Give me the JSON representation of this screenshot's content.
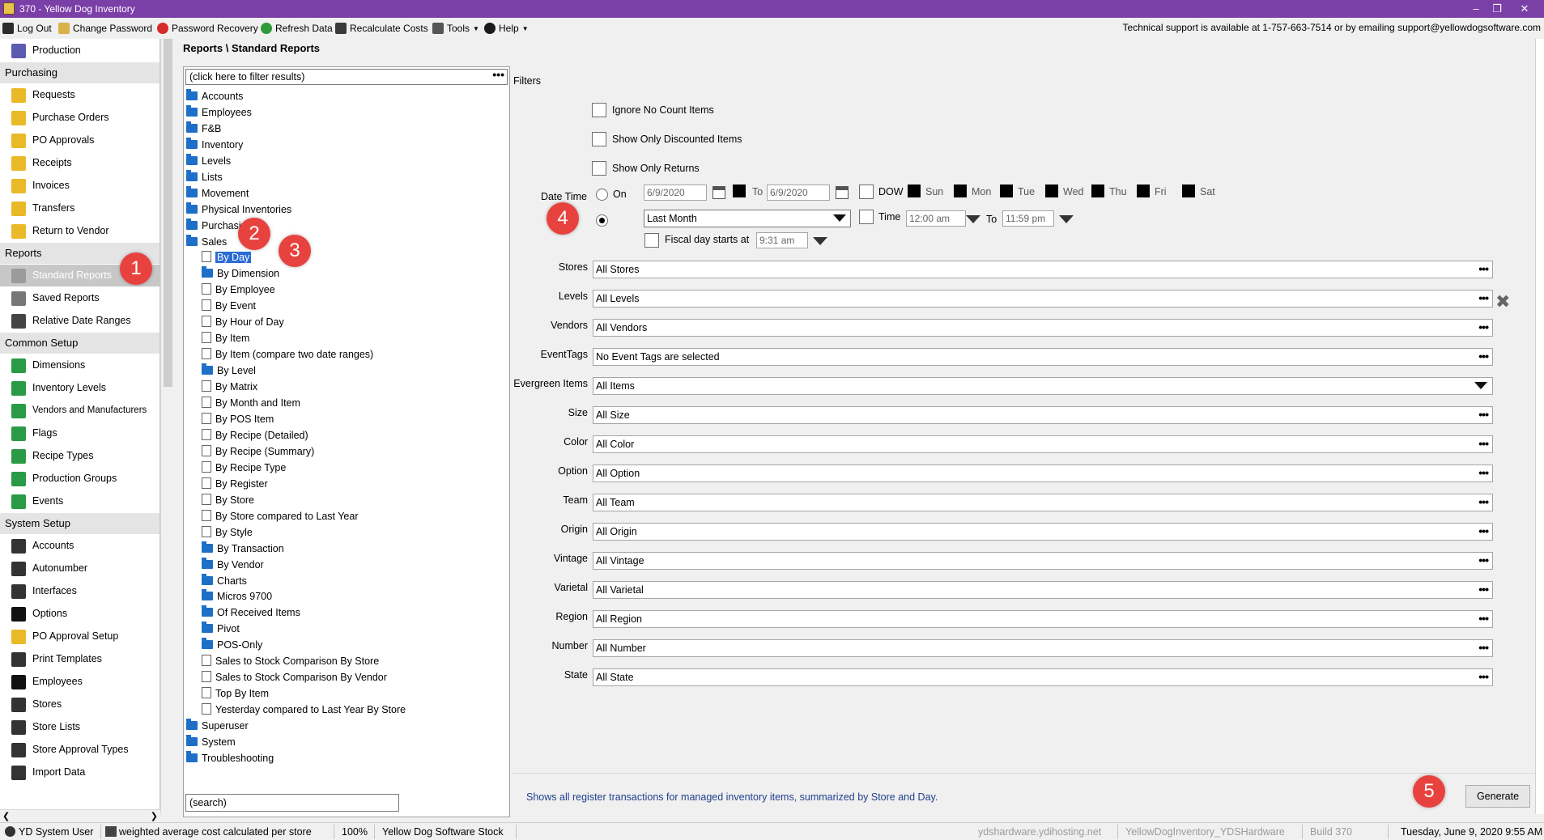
{
  "window": {
    "title": "370 - Yellow Dog Inventory"
  },
  "toolbar": {
    "items": [
      "Log Out",
      "Change Password",
      "Password Recovery",
      "Refresh Data",
      "Recalculate Costs",
      "Tools",
      "Help"
    ],
    "support": "Technical support is available at 1-757-663-7514 or by emailing support@yellowdogsoftware.com"
  },
  "sidebar": {
    "production": "Production",
    "purchasing_header": "Purchasing",
    "purchasing": [
      "Requests",
      "Purchase Orders",
      "PO Approvals",
      "Receipts",
      "Invoices",
      "Transfers",
      "Return to Vendor"
    ],
    "reports_header": "Reports",
    "reports": [
      "Standard Reports",
      "Saved Reports",
      "Relative Date Ranges"
    ],
    "common_header": "Common Setup",
    "common": [
      "Dimensions",
      "Inventory Levels",
      "Vendors and Manufacturers",
      "Flags",
      "Recipe Types",
      "Production Groups",
      "Events"
    ],
    "system_header": "System Setup",
    "system": [
      "Accounts",
      "Autonumber",
      "Interfaces",
      "Options",
      "PO Approval Setup",
      "Print Templates",
      "Employees",
      "Stores",
      "Store Lists",
      "Store Approval Types",
      "Import Data"
    ]
  },
  "breadcrumb": "Reports \\ Standard Reports",
  "tree": {
    "filter_placeholder": "(click here to filter results)",
    "search_placeholder": "(search)",
    "top_folders": [
      "Accounts",
      "Employees",
      "F&B",
      "Inventory",
      "Levels",
      "Lists",
      "Movement",
      "Physical Inventories",
      "Purchasing"
    ],
    "sales_label": "Sales",
    "sales_children": [
      {
        "label": "By Day",
        "type": "doc"
      },
      {
        "label": "By Dimension",
        "type": "folder"
      },
      {
        "label": "By Employee",
        "type": "doc"
      },
      {
        "label": "By Event",
        "type": "doc"
      },
      {
        "label": "By Hour of Day",
        "type": "doc"
      },
      {
        "label": "By Item",
        "type": "doc"
      },
      {
        "label": "By Item (compare two date ranges)",
        "type": "doc"
      },
      {
        "label": "By Level",
        "type": "folder"
      },
      {
        "label": "By Matrix",
        "type": "doc"
      },
      {
        "label": "By Month and Item",
        "type": "doc"
      },
      {
        "label": "By POS Item",
        "type": "doc"
      },
      {
        "label": "By Recipe (Detailed)",
        "type": "doc"
      },
      {
        "label": "By Recipe (Summary)",
        "type": "doc"
      },
      {
        "label": "By Recipe Type",
        "type": "doc"
      },
      {
        "label": "By Register",
        "type": "doc"
      },
      {
        "label": "By Store",
        "type": "doc"
      },
      {
        "label": "By Store compared to Last Year",
        "type": "doc"
      },
      {
        "label": "By Style",
        "type": "doc"
      },
      {
        "label": "By Transaction",
        "type": "folder"
      },
      {
        "label": "By Vendor",
        "type": "folder"
      },
      {
        "label": "Charts",
        "type": "folder"
      },
      {
        "label": "Micros 9700",
        "type": "folder"
      },
      {
        "label": "Of Received Items",
        "type": "folder"
      },
      {
        "label": "Pivot",
        "type": "folder"
      },
      {
        "label": "POS-Only",
        "type": "folder"
      },
      {
        "label": "Sales to Stock Comparison By Store",
        "type": "doc"
      },
      {
        "label": "Sales to Stock Comparison By Vendor",
        "type": "doc"
      },
      {
        "label": "Top By Item",
        "type": "doc"
      },
      {
        "label": "Yesterday compared to Last Year By Store",
        "type": "doc"
      }
    ],
    "bottom_folders": [
      "Superuser",
      "System",
      "Troubleshooting"
    ]
  },
  "filters": {
    "heading": "Filters",
    "checkboxes": [
      "Ignore No Count Items",
      "Show Only Discounted Items",
      "Show Only Returns"
    ],
    "date_time_label": "Date Time",
    "on_label": "On",
    "date_from": "6/9/2020",
    "to_label": "To",
    "date_to": "6/9/2020",
    "dow_label": "DOW",
    "days": [
      "Sun",
      "Mon",
      "Tue",
      "Wed",
      "Thu",
      "Fri",
      "Sat"
    ],
    "range_value": "Last Month",
    "time_label": "Time",
    "time_from": "12:00 am",
    "time_to": "11:59 pm",
    "fiscal_label": "Fiscal day starts at",
    "fiscal_value": "9:31 am",
    "rows": [
      {
        "label": "Stores",
        "value": "All Stores"
      },
      {
        "label": "Levels",
        "value": "All Levels"
      },
      {
        "label": "Vendors",
        "value": "All Vendors"
      },
      {
        "label": "EventTags",
        "value": "No Event Tags are selected"
      },
      {
        "label": "Evergreen Items",
        "value": "All Items"
      },
      {
        "label": "Size",
        "value": "All Size"
      },
      {
        "label": "Color",
        "value": "All Color"
      },
      {
        "label": "Option",
        "value": "All Option"
      },
      {
        "label": "Team",
        "value": "All Team"
      },
      {
        "label": "Origin",
        "value": "All Origin"
      },
      {
        "label": "Vintage",
        "value": "All Vintage"
      },
      {
        "label": "Varietal",
        "value": "All Varietal"
      },
      {
        "label": "Region",
        "value": "All Region"
      },
      {
        "label": "Number",
        "value": "All Number"
      },
      {
        "label": "State",
        "value": "All State"
      }
    ]
  },
  "description": "Shows all register transactions for managed inventory items, summarized by Store and Day.",
  "generate_label": "Generate",
  "badges": [
    "1",
    "2",
    "3",
    "4",
    "5"
  ],
  "status": {
    "user": "YD System User",
    "cost_mode": "weighted average cost calculated per store",
    "zoom": "100%",
    "company": "Yellow Dog Software Stock",
    "host": "ydshardware.ydihosting.net",
    "db": "YellowDogInventory_YDSHardware",
    "build": "Build 370",
    "datetime": "Tuesday, June 9, 2020 9:55 AM"
  },
  "colors": {
    "titlebar": "#7b3fa8",
    "selection": "#2b6cd6",
    "badge": "#e8423f",
    "folder": "#1e6fc8",
    "description": "#1f3f8c"
  }
}
